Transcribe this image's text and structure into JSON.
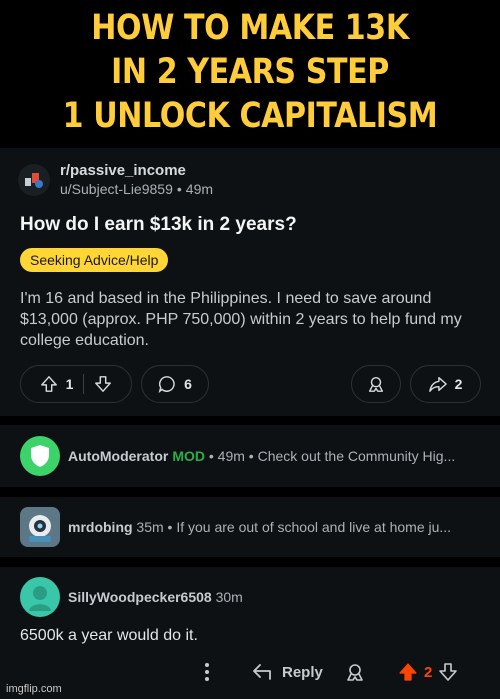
{
  "caption": {
    "line1": "HOW TO MAKE 13K",
    "line2": "IN 2 YEARS STEP",
    "line3": "1 UNLOCK CAPITALISM"
  },
  "post": {
    "subreddit": "r/passive_income",
    "author": "u/Subject-Lie9859",
    "age": "49m",
    "title": "How do I earn $13k in 2 years?",
    "flair": "Seeking Advice/Help",
    "body": "I'm 16 and based in the Philippines. I need to save around $13,000 (approx. PHP 750,000) within 2 years to help fund my college education.",
    "votes": "1",
    "comments": "6",
    "shares": "2"
  },
  "comments": [
    {
      "user": "AutoModerator",
      "badge": "MOD",
      "meta": " • 49m • Check out the Community Hig...",
      "avatar_color": "#3dd36b"
    },
    {
      "user": "mrdobing",
      "meta": " 35m • If you are out of school and live at home ju...",
      "avatar_color": "#5d7787"
    },
    {
      "user": "SillyWoodpecker6508",
      "age": "30m",
      "text": "6500k a year would do it.",
      "avatar_color": "#3ac6a9"
    }
  ],
  "comment_actions": {
    "reply_label": "Reply",
    "votes": "2",
    "upvote_color": "#ff4500"
  },
  "icons": [
    "upvote-icon",
    "downvote-icon",
    "comment-icon",
    "award-icon",
    "share-icon",
    "more-icon",
    "reply-icon"
  ],
  "watermark": "imgflip.com",
  "colors": {
    "caption": "#ffcc3a",
    "flair": "#ffd635",
    "mod": "#2bae4a"
  }
}
